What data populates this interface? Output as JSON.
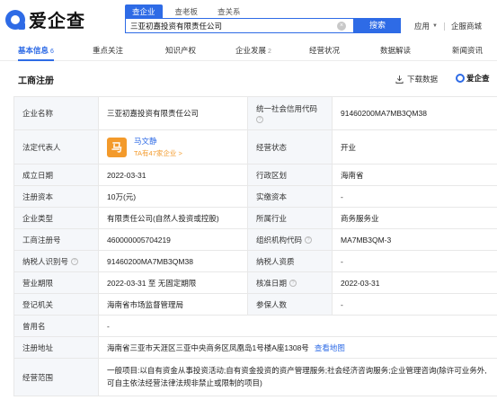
{
  "brand": {
    "logo_text": "爱企查",
    "brand_color": "#2e6be6"
  },
  "search": {
    "tabs": [
      {
        "label": "查企业",
        "active": true
      },
      {
        "label": "查老板",
        "active": false
      },
      {
        "label": "查关系",
        "active": false
      }
    ],
    "query": "三亚初嘉投资有限责任公司",
    "clear_glyph": "×",
    "button_label": "搜索"
  },
  "top_links": {
    "apps": "应用",
    "business": "企服商城"
  },
  "nav": [
    {
      "label": "基本信息",
      "count": "6",
      "active": true
    },
    {
      "label": "重点关注",
      "count": "",
      "active": false
    },
    {
      "label": "知识产权",
      "count": "",
      "active": false
    },
    {
      "label": "企业发展",
      "count": "2",
      "active": false
    },
    {
      "label": "经营状况",
      "count": "",
      "active": false
    },
    {
      "label": "数据解读",
      "count": "",
      "active": false
    },
    {
      "label": "新闻资讯",
      "count": "",
      "active": false
    }
  ],
  "section": {
    "title": "工商注册",
    "download_label": "下载数据",
    "brand_mini": "爱企查"
  },
  "registration": {
    "company_name_label": "企业名称",
    "company_name": "三亚初嘉投资有限责任公司",
    "credit_code_label": "统一社会信用代码",
    "credit_code": "91460200MA7MB3QM38",
    "legal_rep_label": "法定代表人",
    "legal_rep_avatar": "马",
    "legal_rep_name": "马文静",
    "legal_rep_companies": "TA有47家企业 >",
    "status_label": "经营状态",
    "status": "开业",
    "founded_label": "成立日期",
    "founded": "2022-03-31",
    "region_label": "行政区划",
    "region": "海南省",
    "reg_capital_label": "注册资本",
    "reg_capital": "10万(元)",
    "paid_capital_label": "实缴资本",
    "paid_capital": "-",
    "company_type_label": "企业类型",
    "company_type": "有限责任公司(自然人投资或控股)",
    "industry_label": "所属行业",
    "industry": "商务服务业",
    "reg_no_label": "工商注册号",
    "reg_no": "460000005704219",
    "org_code_label": "组织机构代码",
    "org_code": "MA7MB3QM-3",
    "taxpayer_id_label": "纳税人识别号",
    "taxpayer_id": "91460200MA7MB3QM38",
    "taxpayer_quality_label": "纳税人资质",
    "taxpayer_quality": "-",
    "term_label": "营业期限",
    "term": "2022-03-31 至 无固定期限",
    "approval_date_label": "核准日期",
    "approval_date": "2022-03-31",
    "authority_label": "登记机关",
    "authority": "海南省市场监督管理局",
    "insured_label": "参保人数",
    "insured": "-",
    "former_name_label": "曾用名",
    "former_name": "-",
    "address_label": "注册地址",
    "address": "海南省三亚市天涯区三亚中央商务区凤凰岛1号楼A座1308号",
    "map_link": "查看地图",
    "scope_label": "经营范围",
    "scope": "一般项目:以自有资金从事投资活动;自有资金投资的资产管理服务;社会经济咨询服务;企业管理咨询(除许可业务外,可自主依法经营法律法规非禁止或限制的项目)"
  },
  "icons": [
    "logo-icon",
    "clear-icon",
    "chevron-down-icon",
    "download-icon",
    "help-icon"
  ]
}
